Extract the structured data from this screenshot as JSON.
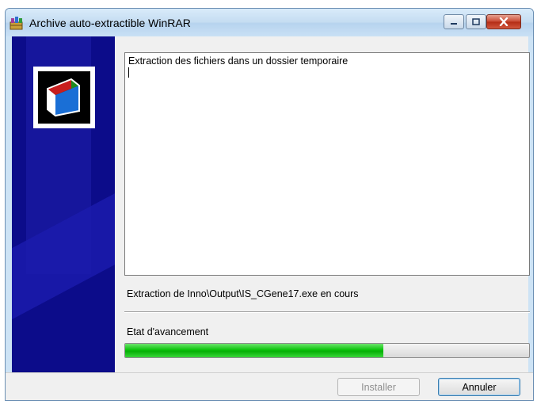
{
  "window": {
    "title": "Archive auto-extractible WinRAR",
    "controls": [
      "minimize",
      "maximize",
      "close"
    ]
  },
  "banner": {
    "logo_icon": "winrar-box-icon"
  },
  "log": {
    "lines": [
      "Extraction des fichiers dans un dossier temporaire"
    ]
  },
  "status": {
    "text": "Extraction de Inno\\Output\\IS_CGene17.exe en cours"
  },
  "progress": {
    "label": "Etat d'avancement",
    "fraction": 0.64,
    "color": "#0cc40c"
  },
  "buttons": {
    "install": {
      "label": "Installer",
      "enabled": false
    },
    "cancel": {
      "label": "Annuler",
      "enabled": true
    }
  }
}
